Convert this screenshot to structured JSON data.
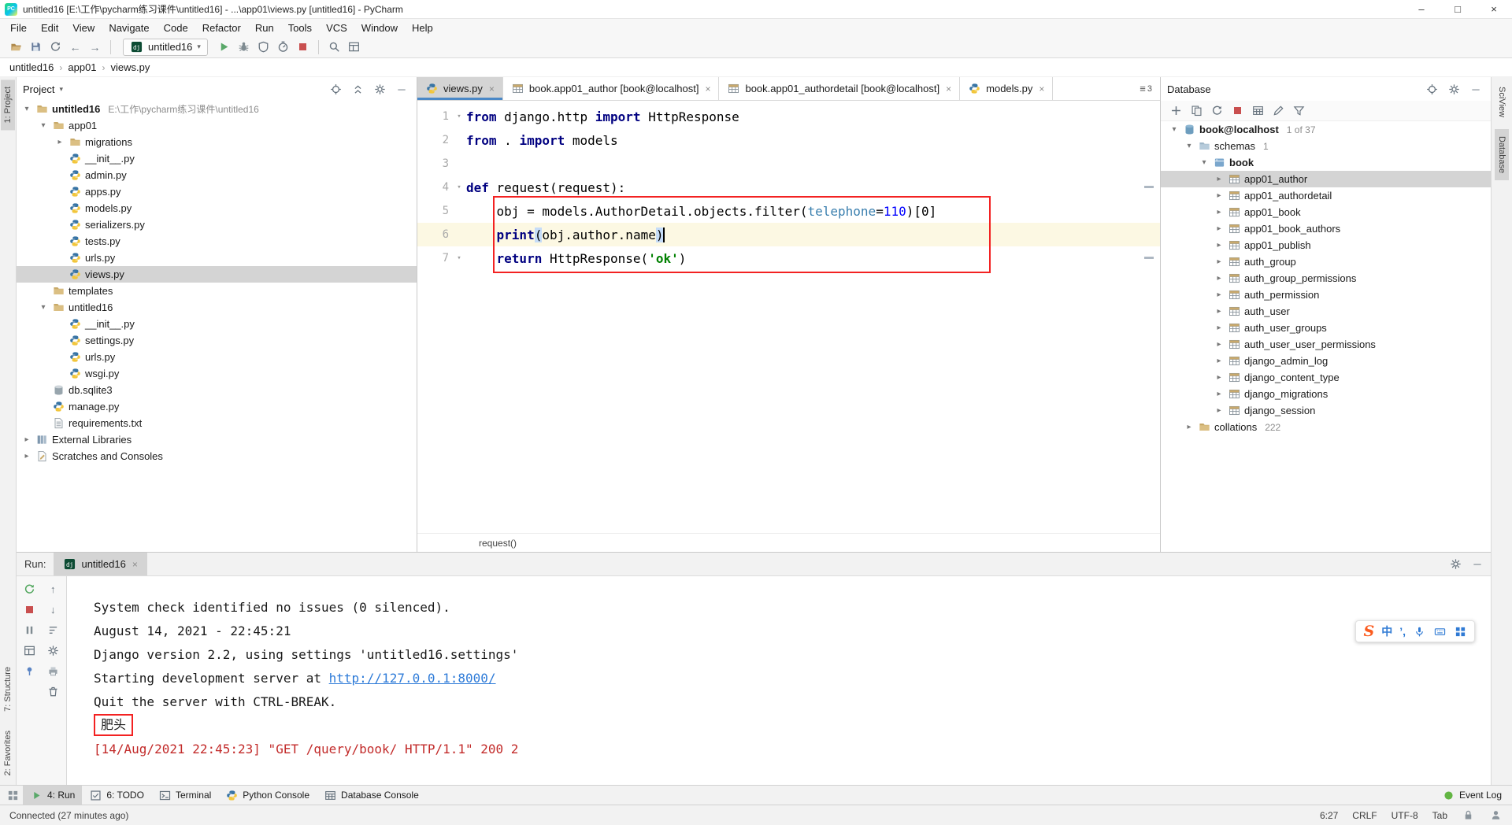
{
  "colors": {
    "annotation_red": "#f32222",
    "console_error_red": "#c22a29",
    "link_blue": "#2e7bd8",
    "selection_gray": "#d4d4d4",
    "current_line_yellow": "#fcf8e3",
    "keyword_blue": "#000080",
    "string_green": "#008000",
    "number_blue": "#0000ff"
  },
  "title_bar": {
    "title": "untitled16 [E:\\工作\\pycharm练习课件\\untitled16] - ...\\app01\\views.py [untitled16] - PyCharm",
    "minimize": "–",
    "maximize": "□",
    "close": "×"
  },
  "menu_bar": {
    "items": [
      "File",
      "Edit",
      "View",
      "Navigate",
      "Code",
      "Refactor",
      "Run",
      "Tools",
      "VCS",
      "Window",
      "Help"
    ]
  },
  "toolbar": {
    "nav_icons": [
      "open-icon",
      "save-all-icon",
      "sync-icon",
      "back-icon",
      "forward-icon"
    ],
    "run_config": {
      "icon": "django-icon",
      "label": "untitled16",
      "chevron": "▾"
    },
    "action_icons": [
      "run-icon",
      "debug-icon",
      "coverage-icon",
      "profiler-icon",
      "stop-icon"
    ],
    "right_icons": [
      "search-icon",
      "layout-icon"
    ]
  },
  "breadcrumbs": {
    "items": [
      "untitled16",
      "app01",
      "views.py"
    ],
    "separator": "›"
  },
  "tool_stripes": {
    "left_top": [
      {
        "label": "1: Project",
        "active": true
      }
    ],
    "left_bottom": [
      {
        "label": "7: Structure",
        "active": false
      },
      {
        "label": "2: Favorites",
        "active": false
      }
    ],
    "right_top": [
      {
        "label": "SciView",
        "active": false
      },
      {
        "label": "Database",
        "active": true
      }
    ]
  },
  "project_panel": {
    "header": "Project",
    "header_icons": [
      "locate-icon",
      "collapse-all-icon",
      "settings-icon",
      "hide-icon"
    ],
    "tree": [
      {
        "level": 0,
        "chevron": "open",
        "icon": "folder-icon",
        "label": "untitled16",
        "extra": "E:\\工作\\pycharm练习课件\\untitled16",
        "bold": true
      },
      {
        "level": 1,
        "chevron": "open",
        "icon": "folder-icon",
        "label": "app01"
      },
      {
        "level": 2,
        "chevron": "closed",
        "icon": "folder-icon",
        "label": "migrations"
      },
      {
        "level": 2,
        "icon": "py-icon",
        "label": "__init__.py"
      },
      {
        "level": 2,
        "icon": "py-icon",
        "label": "admin.py"
      },
      {
        "level": 2,
        "icon": "py-icon",
        "label": "apps.py"
      },
      {
        "level": 2,
        "icon": "py-icon",
        "label": "models.py"
      },
      {
        "level": 2,
        "icon": "py-icon",
        "label": "serializers.py"
      },
      {
        "level": 2,
        "icon": "py-icon",
        "label": "tests.py"
      },
      {
        "level": 2,
        "icon": "py-icon",
        "label": "urls.py"
      },
      {
        "level": 2,
        "icon": "py-icon",
        "label": "views.py",
        "selected": true
      },
      {
        "level": 1,
        "icon": "folder-icon",
        "label": "templates"
      },
      {
        "level": 1,
        "chevron": "open",
        "icon": "folder-icon",
        "label": "untitled16"
      },
      {
        "level": 2,
        "icon": "py-icon",
        "label": "__init__.py"
      },
      {
        "level": 2,
        "icon": "py-icon",
        "label": "settings.py"
      },
      {
        "level": 2,
        "icon": "py-icon",
        "label": "urls.py"
      },
      {
        "level": 2,
        "icon": "py-icon",
        "label": "wsgi.py"
      },
      {
        "level": 1,
        "icon": "sqlite-icon",
        "label": "db.sqlite3"
      },
      {
        "level": 1,
        "icon": "py-icon",
        "label": "manage.py"
      },
      {
        "level": 1,
        "icon": "txt-icon",
        "label": "requirements.txt"
      },
      {
        "level": 0,
        "chevron": "closed",
        "icon": "lib-icon",
        "label": "External Libraries"
      },
      {
        "level": 0,
        "chevron": "closed",
        "icon": "scratch-icon",
        "label": "Scratches and Consoles"
      }
    ]
  },
  "editor": {
    "tabs": [
      {
        "icon": "py-icon",
        "label": "views.py",
        "active": true
      },
      {
        "icon": "table-icon",
        "label": "book.app01_author [book@localhost]"
      },
      {
        "icon": "table-icon",
        "label": "book.app01_authordetail [book@localhost]"
      },
      {
        "icon": "py-icon",
        "label": "models.py"
      }
    ],
    "hidden_tabs": "3",
    "lines": [
      {
        "num": "1",
        "fold": true,
        "tokens": [
          [
            "kw",
            "from"
          ],
          [
            "pl",
            " django.http "
          ],
          [
            "kw",
            "import"
          ],
          [
            "pl",
            " HttpResponse"
          ]
        ]
      },
      {
        "num": "2",
        "tokens": [
          [
            "kw",
            "from"
          ],
          [
            "pl",
            " . "
          ],
          [
            "kw",
            "import"
          ],
          [
            "pl",
            " models"
          ]
        ]
      },
      {
        "num": "3",
        "tokens": []
      },
      {
        "num": "4",
        "fold": true,
        "tokens": [
          [
            "kw",
            "def"
          ],
          [
            "pl",
            " request(request):"
          ]
        ]
      },
      {
        "num": "5",
        "tokens": [
          [
            "pl",
            "    obj = models.AuthorDetail.objects.filter("
          ],
          [
            "arg",
            "telephone"
          ],
          [
            "pl",
            "="
          ],
          [
            "num",
            "110"
          ],
          [
            "pl",
            ")[0]"
          ]
        ]
      },
      {
        "num": "6",
        "current": true,
        "tokens": [
          [
            "pl",
            "    "
          ],
          [
            "kw",
            "print"
          ],
          [
            "match",
            "("
          ],
          [
            "pl",
            "obj.author.name"
          ],
          [
            "match",
            ")"
          ],
          [
            "caret",
            ""
          ]
        ]
      },
      {
        "num": "7",
        "fold": true,
        "tokens": [
          [
            "pl",
            "    "
          ],
          [
            "kw",
            "return"
          ],
          [
            "pl",
            " HttpResponse("
          ],
          [
            "str",
            "'ok'"
          ],
          [
            "pl",
            ")"
          ]
        ]
      }
    ],
    "status_crumb": "request()"
  },
  "database_panel": {
    "header": "Database",
    "header_icons": [
      "locate-icon",
      "settings-icon",
      "hide-icon"
    ],
    "toolbar_icons": [
      "plus-icon",
      "copy-icon",
      "sync-icon",
      "stop-icon",
      "table-view-icon",
      "edit-icon",
      "filter-icon"
    ],
    "tree": [
      {
        "level": 0,
        "chevron": "open",
        "icon": "datasource-icon",
        "label": "book@localhost",
        "extra": "1 of 37",
        "bold": true
      },
      {
        "level": 1,
        "chevron": "open",
        "icon": "schemas-icon",
        "label": "schemas",
        "extra": "1"
      },
      {
        "level": 2,
        "chevron": "open",
        "icon": "schema-icon",
        "label": "book",
        "bold": true
      },
      {
        "level": 3,
        "chevron": "closed",
        "icon": "table-icon",
        "label": "app01_author",
        "selected": true
      },
      {
        "level": 3,
        "chevron": "closed",
        "icon": "table-icon",
        "label": "app01_authordetail"
      },
      {
        "level": 3,
        "chevron": "closed",
        "icon": "table-icon",
        "label": "app01_book"
      },
      {
        "level": 3,
        "chevron": "closed",
        "icon": "table-icon",
        "label": "app01_book_authors"
      },
      {
        "level": 3,
        "chevron": "closed",
        "icon": "table-icon",
        "label": "app01_publish"
      },
      {
        "level": 3,
        "chevron": "closed",
        "icon": "table-icon",
        "label": "auth_group"
      },
      {
        "level": 3,
        "chevron": "closed",
        "icon": "table-icon",
        "label": "auth_group_permissions"
      },
      {
        "level": 3,
        "chevron": "closed",
        "icon": "table-icon",
        "label": "auth_permission"
      },
      {
        "level": 3,
        "chevron": "closed",
        "icon": "table-icon",
        "label": "auth_user"
      },
      {
        "level": 3,
        "chevron": "closed",
        "icon": "table-icon",
        "label": "auth_user_groups"
      },
      {
        "level": 3,
        "chevron": "closed",
        "icon": "table-icon",
        "label": "auth_user_user_permissions"
      },
      {
        "level": 3,
        "chevron": "closed",
        "icon": "table-icon",
        "label": "django_admin_log"
      },
      {
        "level": 3,
        "chevron": "closed",
        "icon": "table-icon",
        "label": "django_content_type"
      },
      {
        "level": 3,
        "chevron": "closed",
        "icon": "table-icon",
        "label": "django_migrations"
      },
      {
        "level": 3,
        "chevron": "closed",
        "icon": "table-icon",
        "label": "django_session"
      },
      {
        "level": 1,
        "chevron": "closed",
        "icon": "folder-icon",
        "label": "collations",
        "extra": "222"
      }
    ]
  },
  "run_panel": {
    "label": "Run:",
    "tab": {
      "icon": "django-icon",
      "label": "untitled16"
    },
    "header_icons": [
      "settings-icon",
      "hide-icon"
    ],
    "toolbar_col1": [
      "rerun-icon",
      "stop-icon",
      "pause-icon",
      "layout-icon",
      "pin-icon"
    ],
    "toolbar_col2": [
      "up-icon",
      "down-icon",
      "sort-icon",
      "settings-icon",
      "print-icon",
      "clear-icon"
    ],
    "console": [
      {
        "type": "plain",
        "text": "System check identified no issues (0 silenced)."
      },
      {
        "type": "plain",
        "text": "August 14, 2021 - 22:45:21"
      },
      {
        "type": "plain",
        "text": "Django version 2.2, using settings 'untitled16.settings'"
      },
      {
        "type": "link",
        "prefix": "Starting development server at ",
        "link": "http://127.0.0.1:8000/"
      },
      {
        "type": "plain",
        "text": "Quit the server with CTRL-BREAK."
      },
      {
        "type": "boxed",
        "text": "肥头"
      },
      {
        "type": "error",
        "text": "[14/Aug/2021 22:45:23] \"GET /query/book/ HTTP/1.1\" 200 2"
      }
    ]
  },
  "ime_toolbar": {
    "logo": "S",
    "lang": "中",
    "punct": "’,",
    "icons": [
      "mic-icon",
      "keyboard-icon",
      "grid4-icon"
    ]
  },
  "bottom_bar": {
    "switcher": "switcher-icon",
    "left": [
      {
        "icon": "run-triangle-icon",
        "label": "4: Run",
        "active": true
      },
      {
        "icon": "todo-icon",
        "label": "6: TODO"
      },
      {
        "icon": "terminal-icon",
        "label": "Terminal"
      },
      {
        "icon": "python-icon",
        "label": "Python Console"
      },
      {
        "icon": "table-view-icon",
        "label": "Database Console"
      }
    ],
    "right": [
      {
        "icon": "event-log-icon",
        "label": "Event Log"
      }
    ]
  },
  "status_bar": {
    "message": "Connected (27 minutes ago)",
    "position": "6:27",
    "line_sep": "CRLF",
    "encoding": "UTF-8",
    "indent": "Tab",
    "icons": [
      "lock-icon",
      "hector-icon"
    ]
  }
}
